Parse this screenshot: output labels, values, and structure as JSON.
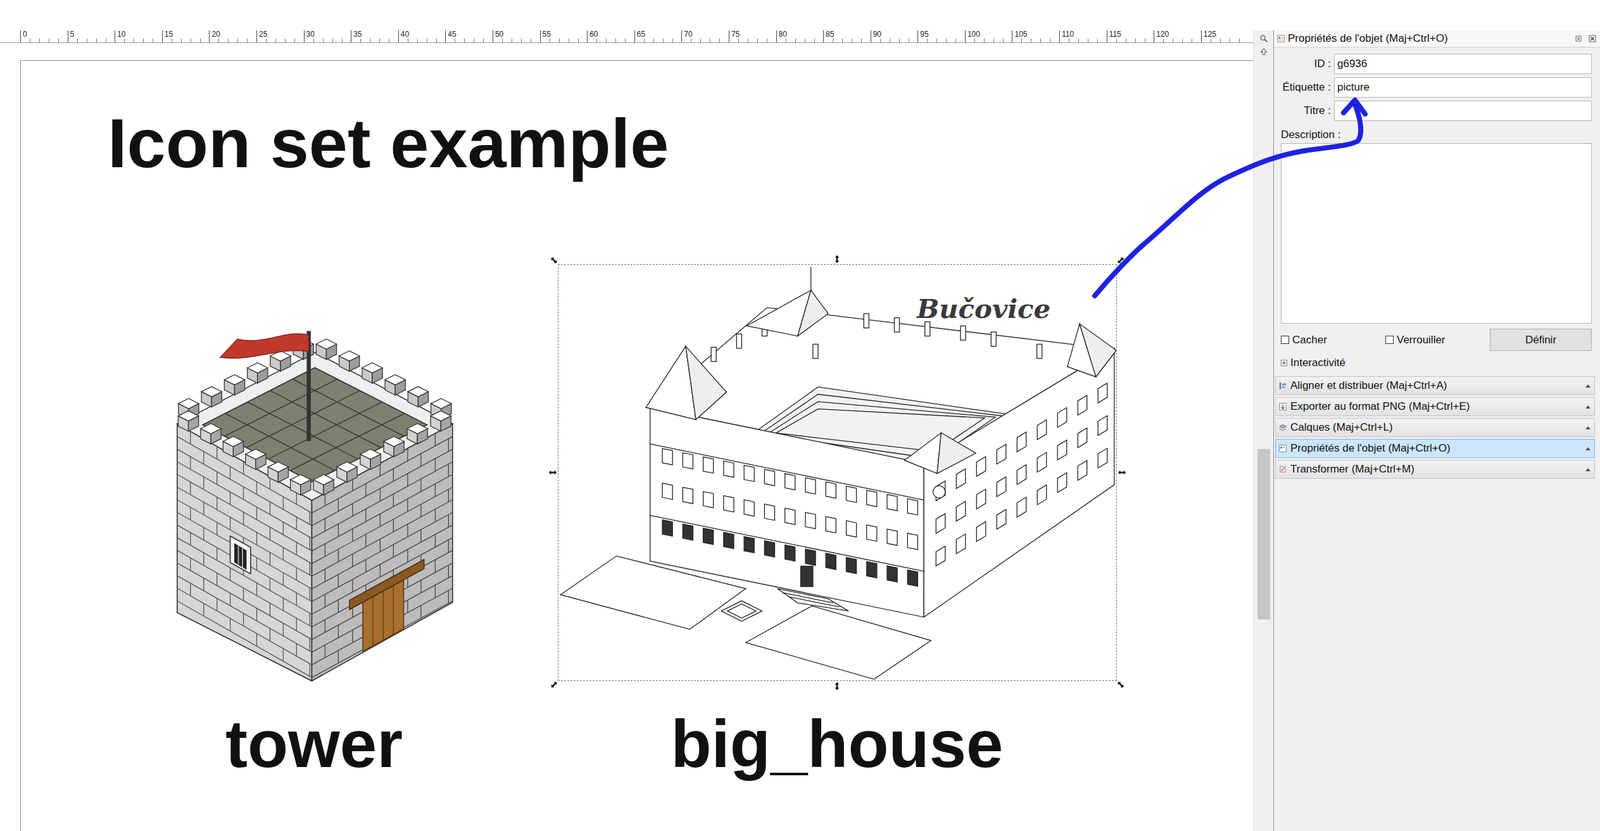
{
  "ruler": {
    "ticks": [
      "0",
      "5",
      "10",
      "15",
      "20",
      "25",
      "30",
      "35",
      "40",
      "45",
      "50",
      "55",
      "60",
      "65",
      "70",
      "75",
      "80",
      "85",
      "90",
      "95",
      "100",
      "105",
      "110",
      "115",
      "120",
      "125"
    ]
  },
  "canvas": {
    "title": "Icon set example",
    "icons": [
      {
        "label": "tower",
        "selected": false
      },
      {
        "label": "big_house",
        "selected": true,
        "caption": "Bučovice"
      }
    ]
  },
  "panel": {
    "title": "Propriétés de l'objet (Maj+Ctrl+O)",
    "fields": [
      {
        "label": "ID :",
        "value": "g6936"
      },
      {
        "label": "Étiquette :",
        "value": "picture"
      },
      {
        "label": "Titre :",
        "value": ""
      }
    ],
    "description_label": "Description :",
    "description": "",
    "checkboxes": [
      {
        "label": "Cacher",
        "checked": false
      },
      {
        "label": "Verrouiller",
        "checked": false
      }
    ],
    "set_button": "Définir",
    "expander": {
      "label": "Interactivité",
      "expanded": false
    }
  },
  "docks": [
    {
      "label": "Aligner et distribuer (Maj+Ctrl+A)",
      "selected": false
    },
    {
      "label": "Exporter au format PNG (Maj+Ctrl+E)",
      "selected": false
    },
    {
      "label": "Calques (Maj+Ctrl+L)",
      "selected": false
    },
    {
      "label": "Propriétés de l'objet (Maj+Ctrl+O)",
      "selected": true
    },
    {
      "label": "Transformer (Maj+Ctrl+M)",
      "selected": false
    }
  ]
}
